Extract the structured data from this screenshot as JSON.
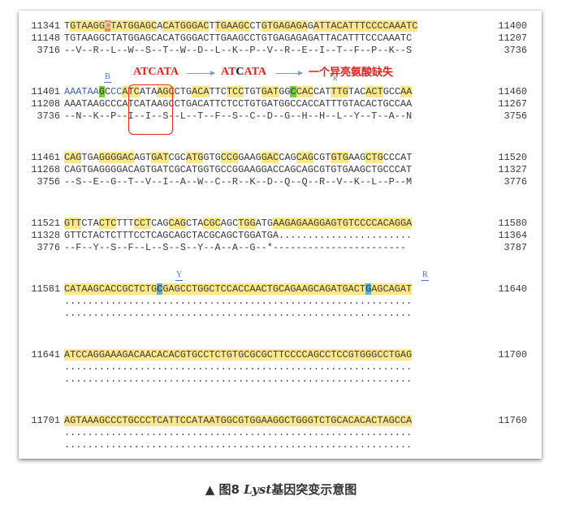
{
  "blocks": [
    {
      "lines": [
        {
          "left": "11341",
          "right": "11400",
          "segs": [
            [
              "T",
              ""
            ],
            [
              "GTAAGG",
              "y"
            ],
            [
              "C",
              "mutO"
            ],
            [
              "TATGGAGC",
              "y"
            ],
            [
              "A",
              ""
            ],
            [
              "CATGGGAC",
              "y"
            ],
            [
              "T",
              ""
            ],
            [
              "TGAAGC",
              "y"
            ],
            [
              "CT",
              ""
            ],
            [
              "GTGAGAGA",
              "y"
            ],
            [
              "G",
              ""
            ],
            [
              "ATTACATTTC",
              "y"
            ],
            [
              "CCCAAATC",
              "y"
            ]
          ]
        },
        {
          "left": "11148",
          "right": "11207",
          "segs": [
            [
              "TGTAAGGCTATGGAGCACATGGGACTTGAAGCCTGTGAGAGAGATTACATTTCCCAAATC",
              ""
            ]
          ]
        },
        {
          "left": "3716",
          "right": "3736",
          "segs": [
            [
              "--V--R--L--W--S--T--W--D--L--K--P--V--R--E--I--T--F--P--K--S",
              ""
            ]
          ]
        }
      ]
    },
    {
      "lines": [
        {
          "left": "11401",
          "right": "11460",
          "segs": [
            [
              "AAATAA",
              "b"
            ],
            [
              "G",
              "mutG"
            ],
            [
              "C",
              ""
            ],
            [
              "CC",
              "b"
            ],
            [
              "ATC",
              "y"
            ],
            [
              "ATA",
              ""
            ],
            [
              "AGC",
              "y"
            ],
            [
              "CTG",
              ""
            ],
            [
              "ACA",
              "y"
            ],
            [
              "TTC",
              ""
            ],
            [
              "TCC",
              "y"
            ],
            [
              "TGT",
              ""
            ],
            [
              "GAT",
              "y"
            ],
            [
              "GG",
              ""
            ],
            [
              "C",
              "mutG"
            ],
            [
              "CAC",
              "y"
            ],
            [
              "CAT",
              ""
            ],
            [
              "TTG",
              "y"
            ],
            [
              "TAC",
              ""
            ],
            [
              "ACT",
              "y"
            ],
            [
              "GCC",
              ""
            ],
            [
              "AA",
              "y"
            ]
          ]
        },
        {
          "left": "11208",
          "right": "11267",
          "segs": [
            [
              "AAATAAGCCCATCATAAGCCTGACATTCTCCTGTGATGGCCACCATTTGTACACTGCCAA",
              ""
            ]
          ]
        },
        {
          "left": "3736",
          "right": "3756",
          "segs": [
            [
              "--N--K--P--I--I--S--L--T--F--S--C--D--G--H--H--L--Y--T--A--N",
              ""
            ]
          ]
        }
      ]
    },
    {
      "lines": [
        {
          "left": "11461",
          "right": "11520",
          "segs": [
            [
              "CAG",
              "y"
            ],
            [
              "TGA",
              ""
            ],
            [
              "GGG",
              "y"
            ],
            [
              "GAC",
              "y"
            ],
            [
              "AGT",
              ""
            ],
            [
              "GAT",
              "y"
            ],
            [
              "CGC",
              ""
            ],
            [
              "ATG",
              "y"
            ],
            [
              "GTG",
              ""
            ],
            [
              "CCG",
              "y"
            ],
            [
              "GAAG",
              ""
            ],
            [
              "GAC",
              "y"
            ],
            [
              "CAG",
              ""
            ],
            [
              "CAG",
              "y"
            ],
            [
              "CGT",
              ""
            ],
            [
              "GTG",
              "y"
            ],
            [
              "AAG",
              ""
            ],
            [
              "CTG",
              "y"
            ],
            [
              "CCCAT",
              ""
            ]
          ]
        },
        {
          "left": "11268",
          "right": "11327",
          "segs": [
            [
              "CAGTGAGGGGACAGTGATCGCATGGTGCCGGAAGGACCAGCAGCGTGTGAAGCTGCCCAT",
              ""
            ]
          ]
        },
        {
          "left": "3756",
          "right": "3776",
          "segs": [
            [
              "--S--E--G--T--V--I--A--W--C--R--K--D--Q--Q--R--V--K--L--P--M",
              ""
            ]
          ]
        }
      ]
    },
    {
      "lines": [
        {
          "left": "11521",
          "right": "11580",
          "segs": [
            [
              "GTT",
              "y"
            ],
            [
              "CTA",
              ""
            ],
            [
              "CTC",
              "y"
            ],
            [
              "TTT",
              ""
            ],
            [
              "CCT",
              "y"
            ],
            [
              "CAG",
              ""
            ],
            [
              "CAG",
              "y"
            ],
            [
              "CTA",
              ""
            ],
            [
              "CGC",
              "y"
            ],
            [
              "AGC",
              ""
            ],
            [
              "TGG",
              "y"
            ],
            [
              "ATG",
              ""
            ],
            [
              "AAGAGAAGGAGTGTCCCCACAGGA",
              "y"
            ]
          ]
        },
        {
          "left": "11328",
          "right": "11364",
          "segs": [
            [
              "GTTCTACTCTTTCCTCAGCAGCTACGCAGCTGGATGA.......................",
              ""
            ]
          ]
        },
        {
          "left": "3776",
          "right": "3787",
          "segs": [
            [
              "--F--Y--S--F--L--S--S--Y--A--A--G--*-----------------------",
              ""
            ]
          ]
        }
      ]
    },
    {
      "lines": [
        {
          "left": "11581",
          "right": "11640",
          "segs": [
            [
              "CATAAGCACCGCTCTG",
              "y"
            ],
            [
              "C",
              "mutB"
            ],
            [
              "GAGCCTGGCTCCACCAACTGCAGAAGCAGATGACT",
              "y"
            ],
            [
              "G",
              "mutB"
            ],
            [
              "AGCAGAT",
              "y"
            ]
          ]
        },
        {
          "left": "",
          "right": "",
          "segs": [
            [
              "............................................................",
              ""
            ]
          ]
        },
        {
          "left": "",
          "right": "",
          "segs": [
            [
              "............................................................",
              ""
            ]
          ]
        }
      ]
    },
    {
      "lines": [
        {
          "left": "11641",
          "right": "11700",
          "segs": [
            [
              "ATCCAGGAAAGACAACACACGTGCCTCTGTGCGCGCTTCCCCAGCCTCCGTGGGCCTGAG",
              "y"
            ]
          ]
        },
        {
          "left": "",
          "right": "",
          "segs": [
            [
              "............................................................",
              ""
            ]
          ]
        },
        {
          "left": "",
          "right": "",
          "segs": [
            [
              "............................................................",
              ""
            ]
          ]
        }
      ]
    },
    {
      "lines": [
        {
          "left": "11701",
          "right": "11760",
          "segs": [
            [
              "AGTAAAGCCCTGCCCTCATTCCATAATGGCGTGGAAGGCTGGGTCTGCACACACTAGCCA",
              "y"
            ]
          ]
        },
        {
          "left": "",
          "right": "",
          "segs": [
            [
              "............................................................",
              ""
            ]
          ]
        },
        {
          "left": "",
          "right": "",
          "segs": [
            [
              "............................................................",
              ""
            ]
          ]
        }
      ]
    }
  ],
  "annotations": {
    "b_mark": "B",
    "r_mark1": "R",
    "y_mark": "Y",
    "r_mark2": "R"
  },
  "mutation_note": {
    "seq1_part1": "ATC",
    "seq1_part2": "ATA",
    "seq2_part1": "AT",
    "seq2_mid": "C",
    "seq2_part2": "ATA",
    "effect": "一个异亮氨酸缺失"
  },
  "caption": {
    "prefix": "▲ 图8 ",
    "gene": "Lyst",
    "suffix": "基因突变示意图"
  },
  "colors": {
    "highlight": "#fce88a",
    "orange_mutation": "#f08a5d",
    "green_mutation": "#7ac943",
    "blue_mutation": "#5fb3d6",
    "annotation_red": "#e8221b",
    "arrow_blue": "#7b9de0"
  }
}
